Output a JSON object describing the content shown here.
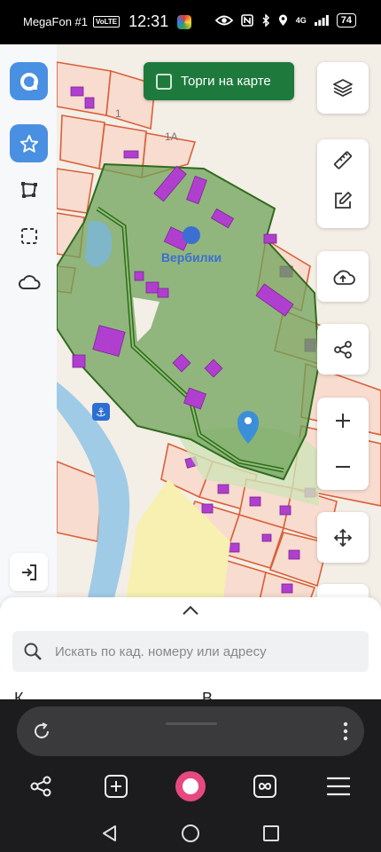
{
  "status_bar": {
    "carrier": "MegaFon #1",
    "volte": "VoLTE",
    "time": "12:31",
    "network": "4G",
    "battery": "74"
  },
  "map": {
    "place_label": "Вербилки",
    "parcel_labels": [
      "1",
      "1А"
    ],
    "torgi_label": "Торги на карте",
    "colors": {
      "accent": "#4a90e2",
      "torgi": "#1e7a3c",
      "area_fill": "#6fa35a",
      "building": "#b03fd0",
      "parcel_border": "#d9603a",
      "pin": "#3b8fd9"
    }
  },
  "left_tools": [
    "app-logo-icon",
    "star-icon",
    "polygon-icon",
    "selection-icon",
    "cloud-icon",
    "login-icon"
  ],
  "right_tools": [
    "layers-icon",
    "ruler-icon",
    "edit-icon",
    "upload-icon",
    "share-icon",
    "zoom-in-icon",
    "zoom-out-icon",
    "move-icon"
  ],
  "sheet": {
    "search_placeholder": "Искать по кад. номеру или адресу",
    "peek_left": "К",
    "peek_right": "В"
  },
  "browser": {
    "nav": [
      "share-icon",
      "new-tab-icon",
      "alice-icon",
      "tabs-icon",
      "menu-icon"
    ],
    "system": [
      "back-icon",
      "home-icon",
      "recents-icon"
    ]
  }
}
